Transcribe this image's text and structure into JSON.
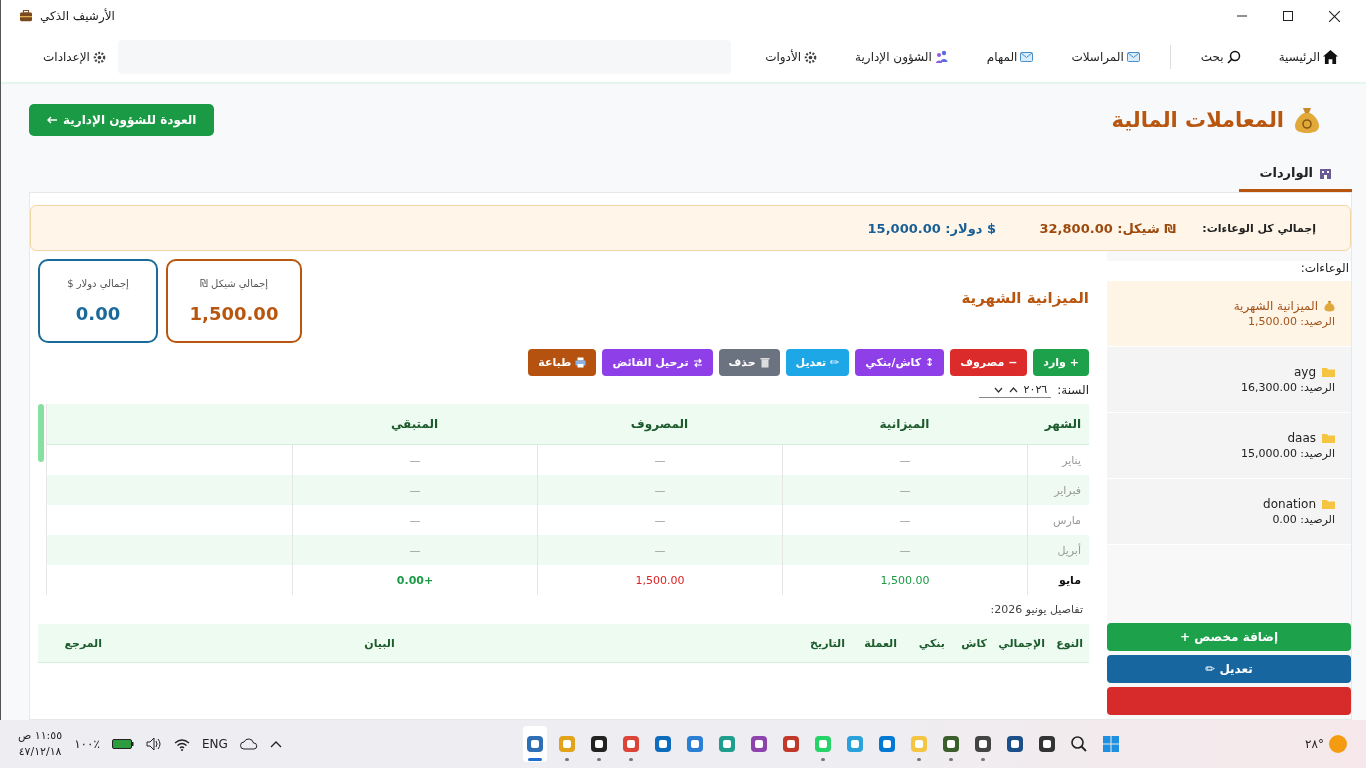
{
  "window": {
    "title": "الأرشيف الذكي"
  },
  "nav": {
    "primary": [
      {
        "label": "الرئيسية",
        "kind": "home"
      },
      {
        "label": "بحث",
        "kind": "search"
      }
    ],
    "sections": [
      {
        "label": "المراسلات",
        "kind": "mail"
      },
      {
        "label": "المهام",
        "kind": "mail"
      },
      {
        "label": "الشؤون الإدارية",
        "kind": "people"
      },
      {
        "label": "الأدوات",
        "kind": "gear"
      }
    ],
    "settings": "الإعدادات"
  },
  "page": {
    "title": "المعاملات المالية",
    "back_button": "العودة للشؤون الإدارية"
  },
  "tabs": [
    {
      "label": "الواردات",
      "selected": true
    }
  ],
  "summary": {
    "label": "إجمالي كل الوعاءات:",
    "shekel": "₪ شيكل: 32,800.00",
    "dollar": "$ دولار: 15,000.00"
  },
  "containers": {
    "title": "الوعاءات:",
    "items": [
      {
        "name": "الميزانية الشهرية",
        "balance": "الرصيد: 1,500.00",
        "kind": "budget",
        "selected": true
      },
      {
        "name": "ayg",
        "balance": "الرصيد: 16,300.00",
        "kind": "folder",
        "selected": false
      },
      {
        "name": "daas",
        "balance": "الرصيد: 15,000.00",
        "kind": "folder",
        "selected": false
      },
      {
        "name": "donation",
        "balance": "الرصيد: 0.00",
        "kind": "folder",
        "selected": false
      }
    ],
    "actions": [
      {
        "label": "+ إضافة مخصص",
        "kind": "add"
      },
      {
        "label": "✏ تعديل",
        "kind": "edit"
      },
      {
        "kind": "danger"
      }
    ]
  },
  "cards": [
    {
      "label": "إجمالي شيكل ₪",
      "value": "1,500.00",
      "kind": "shekel"
    },
    {
      "label": "إجمالي دولار $",
      "value": "0.00",
      "kind": "dollar"
    }
  ],
  "budget": {
    "title": "الميزانية الشهرية",
    "year_label": "السنة:",
    "year": "٢٠٢٦",
    "actions": [
      {
        "label": "+ وارد",
        "kind": "income"
      },
      {
        "label": "− مصروف",
        "kind": "expense"
      },
      {
        "label": "↕ كاش/بنكي",
        "kind": "transfer"
      },
      {
        "label": "✏ تعديل",
        "kind": "edit"
      },
      {
        "label": "حذف",
        "kind": "delete"
      },
      {
        "label": "ترحيل الفائض",
        "kind": "carry"
      },
      {
        "label": "طباعة",
        "kind": "print"
      }
    ]
  },
  "months": {
    "columns": [
      "الشهر",
      "الميزانية",
      "المصروف",
      "المتبقي"
    ],
    "rows": [
      {
        "month": "يناير",
        "budget": "—",
        "spent": "—",
        "remaining": "—",
        "has_data": false
      },
      {
        "month": "فبراير",
        "budget": "—",
        "spent": "—",
        "remaining": "—",
        "has_data": false
      },
      {
        "month": "مارس",
        "budget": "—",
        "spent": "—",
        "remaining": "—",
        "has_data": false
      },
      {
        "month": "أبريل",
        "budget": "—",
        "spent": "—",
        "remaining": "—",
        "has_data": false
      },
      {
        "month": "مايو",
        "budget": "1,500.00",
        "spent": "1,500.00",
        "remaining": "+0.00",
        "has_data": true
      }
    ]
  },
  "details": {
    "title": "تفاصيل يونيو 2026:",
    "columns": [
      "النوع",
      "الإجمالي",
      "كاش",
      "بنكي",
      "العملة",
      "التاريخ",
      "البيان",
      "المرجع"
    ]
  },
  "taskbar": {
    "time": "١١:٥٥ ص",
    "date": "٤٧/١٢/١٨",
    "battery": "١٠٠٪",
    "language": "ENG",
    "temperature": "٢٨°",
    "apps": [
      {
        "kind": "app",
        "color": "#2f6fb5",
        "running": true,
        "selected": true
      },
      {
        "kind": "app",
        "color": "#e2a21a",
        "running": true,
        "selected": false
      },
      {
        "kind": "app",
        "color": "#222222",
        "running": true,
        "selected": false
      },
      {
        "kind": "app",
        "color": "#db4437",
        "running": true,
        "selected": false
      },
      {
        "kind": "app",
        "color": "#0f6cbd",
        "running": false,
        "selected": false
      },
      {
        "kind": "app",
        "color": "#2a7fd4",
        "running": false,
        "selected": false
      },
      {
        "kind": "app",
        "color": "#1f9e8e",
        "running": false,
        "selected": false
      },
      {
        "kind": "app",
        "color": "#8e44ad",
        "running": false,
        "selected": false
      },
      {
        "kind": "app",
        "color": "#c0392b",
        "running": false,
        "selected": false
      },
      {
        "kind": "app",
        "color": "#25d366",
        "running": true,
        "selected": false
      },
      {
        "kind": "app",
        "color": "#2aa1da",
        "running": false,
        "selected": false
      },
      {
        "kind": "app",
        "color": "#0078d4",
        "running": false,
        "selected": false
      },
      {
        "kind": "app",
        "color": "#f4c542",
        "running": true,
        "selected": false
      },
      {
        "kind": "app",
        "color": "#3b5f2a",
        "running": true,
        "selected": false
      },
      {
        "kind": "app",
        "color": "#444444",
        "running": true,
        "selected": false
      },
      {
        "kind": "app",
        "color": "#1b4f8a",
        "running": false,
        "selected": false
      },
      {
        "kind": "app",
        "color": "#333333",
        "running": false,
        "selected": false
      },
      {
        "kind": "search",
        "running": false,
        "selected": false
      },
      {
        "kind": "start",
        "running": false,
        "selected": false
      }
    ]
  }
}
